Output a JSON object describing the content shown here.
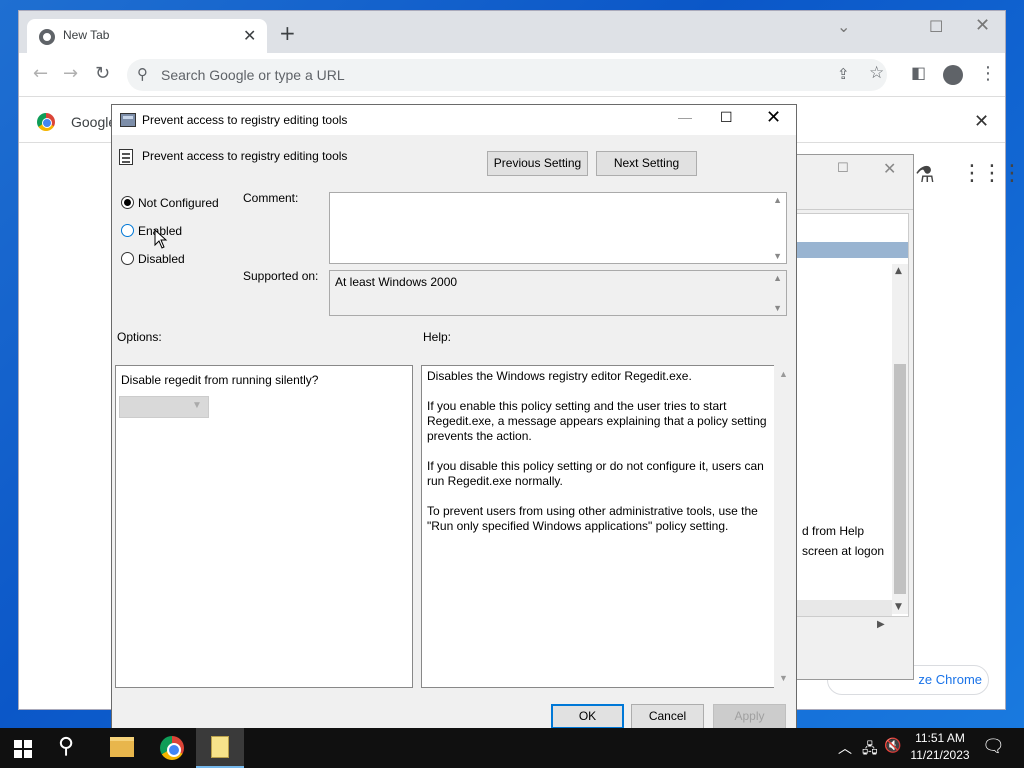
{
  "chrome": {
    "tab_title": "New Tab",
    "omnibox_placeholder": "Search Google or type a URL",
    "infobar_text": "Google",
    "customize_label": "ze Chrome"
  },
  "background_window": {
    "text_line1": "d from Help",
    "text_line2": "screen at logon"
  },
  "dialog": {
    "title": "Prevent access to registry editing tools",
    "policy_name": "Prevent access to registry editing tools",
    "previous_label": "Previous Setting",
    "next_label": "Next Setting",
    "radio_not_configured": "Not Configured",
    "radio_enabled": "Enabled",
    "radio_disabled": "Disabled",
    "selected_state": "Not Configured",
    "comment_label": "Comment:",
    "comment_value": "",
    "supported_label": "Supported on:",
    "supported_value": "At least Windows 2000",
    "options_label": "Options:",
    "help_label": "Help:",
    "options_question": "Disable regedit from running silently?",
    "help_p1": "Disables the Windows registry editor Regedit.exe.",
    "help_p2": "If you enable this policy setting and the user tries to start Regedit.exe, a message appears explaining that a policy setting prevents the action.",
    "help_p3": "If you disable this policy setting or do not configure it, users can run Regedit.exe normally.",
    "help_p4": "To prevent users from using other administrative tools, use the \"Run only specified Windows applications\" policy setting.",
    "ok_label": "OK",
    "cancel_label": "Cancel",
    "apply_label": "Apply"
  },
  "taskbar": {
    "time": "11:51 AM",
    "date": "11/21/2023"
  },
  "colors": {
    "accent": "#0078d7",
    "chrome_link": "#1a73e8",
    "taskbar": "#101010"
  }
}
